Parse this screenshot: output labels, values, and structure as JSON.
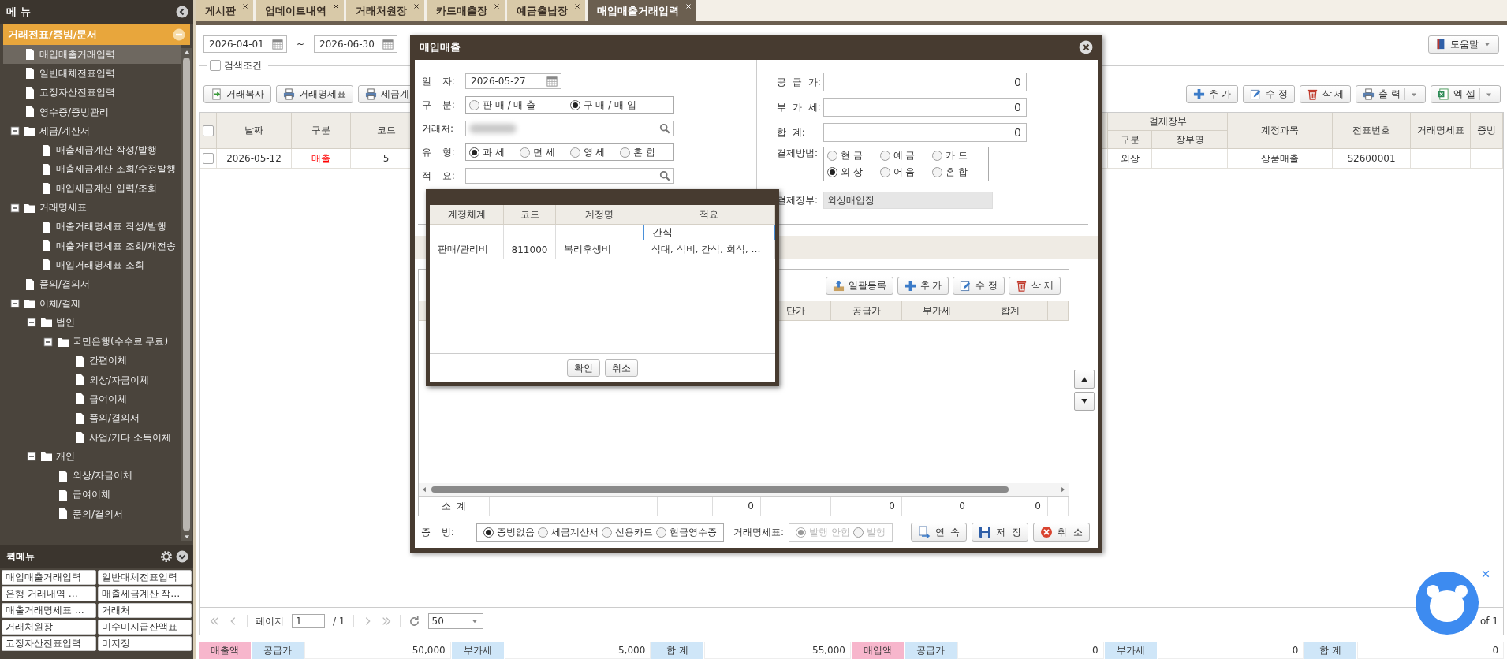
{
  "sidebar": {
    "title": "메 뉴",
    "section": {
      "label": "거래전표/증빙/문서",
      "expanded": true
    },
    "items": [
      {
        "label": "매입매출거래입력",
        "kind": "page",
        "selected": true
      },
      {
        "label": "일반대체전표입력",
        "kind": "page",
        "selected": false
      },
      {
        "label": "고정자산전표입력",
        "kind": "page",
        "selected": false
      },
      {
        "label": "영수증/증빙관리",
        "kind": "page",
        "selected": false
      },
      {
        "label": "세금/계산서",
        "kind": "folder",
        "selected": false,
        "expanded": true,
        "children": [
          {
            "label": "매출세금계산 작성/발행",
            "kind": "page",
            "selected": false
          },
          {
            "label": "매출세금계산 조회/수정발행",
            "kind": "page",
            "selected": false
          },
          {
            "label": "매입세금계산 입력/조회",
            "kind": "page",
            "selected": false
          }
        ]
      },
      {
        "label": "거래명세표",
        "kind": "folder",
        "selected": false,
        "expanded": true,
        "children": [
          {
            "label": "매출거래명세표 작성/발행",
            "kind": "page",
            "selected": false
          },
          {
            "label": "매출거래명세표 조회/재전송",
            "kind": "page",
            "selected": false
          },
          {
            "label": "매입거래명세표 조회",
            "kind": "page",
            "selected": false
          }
        ]
      },
      {
        "label": "품의/결의서",
        "kind": "page",
        "selected": false
      },
      {
        "label": "이체/결제",
        "kind": "folder",
        "selected": false,
        "expanded": true,
        "children": [
          {
            "label": "법인",
            "kind": "folder",
            "selected": false,
            "expanded": true,
            "children": [
              {
                "label": "국민은행(수수료 무료)",
                "kind": "folder",
                "selected": false,
                "expanded": true,
                "children": [
                  {
                    "label": "간편이체",
                    "kind": "page",
                    "selected": false
                  },
                  {
                    "label": "외상/자금이체",
                    "kind": "page",
                    "selected": false
                  },
                  {
                    "label": "급여이체",
                    "kind": "page",
                    "selected": false
                  },
                  {
                    "label": "품의/결의서",
                    "kind": "page",
                    "selected": false
                  },
                  {
                    "label": "사업/기타 소득이체",
                    "kind": "page",
                    "selected": false
                  }
                ]
              }
            ]
          },
          {
            "label": "개인",
            "kind": "folder",
            "selected": false,
            "expanded": true,
            "children": [
              {
                "label": "외상/자금이체",
                "kind": "page",
                "selected": false
              },
              {
                "label": "급여이체",
                "kind": "page",
                "selected": false
              },
              {
                "label": "품의/결의서",
                "kind": "page",
                "selected": false
              }
            ]
          }
        ]
      }
    ]
  },
  "quick_menu": {
    "title": "퀵메뉴",
    "items": [
      "매입매출거래입력",
      "일반대체전표입력",
      "은행 거래내역 …",
      "매출세금계산 작…",
      "매출거래명세표 …",
      "거래처",
      "거래처원장",
      "미수미지급잔액표",
      "고정자산전표입력",
      "미지정"
    ]
  },
  "tabs": [
    {
      "label": "게시판",
      "selected": false
    },
    {
      "label": "업데이트내역",
      "selected": false
    },
    {
      "label": "거래처원장",
      "selected": false
    },
    {
      "label": "카드매출장",
      "selected": false
    },
    {
      "label": "예금출납장",
      "selected": false
    },
    {
      "label": "매입매출거래입력",
      "selected": true
    }
  ],
  "filters": {
    "date_from": "2026-04-01",
    "separator": "~",
    "date_to": "2026-06-30",
    "help": "도움말"
  },
  "search_condition": {
    "label": "검색조건",
    "checked": false
  },
  "left_buttons": [
    {
      "label": "거래복사",
      "kind": "copy"
    },
    {
      "label": "거래명세표",
      "kind": "statement"
    },
    {
      "label": "세금계",
      "kind": "tax"
    }
  ],
  "right_buttons": [
    {
      "label": "추 가",
      "kind": "add"
    },
    {
      "label": "수 정",
      "kind": "edit"
    },
    {
      "label": "삭 제",
      "kind": "delete"
    },
    {
      "label": "출 력",
      "kind": "print",
      "dropdown": true
    },
    {
      "label": "엑 셀",
      "kind": "excel",
      "dropdown": true
    }
  ],
  "grid": {
    "header_checked": false,
    "columns": [
      {
        "label": "날짜"
      },
      {
        "label": "구분"
      },
      {
        "label": "코드"
      },
      {
        "label": "결제장부",
        "children": [
          "구분",
          "장부명"
        ]
      },
      {
        "label": "계정과목"
      },
      {
        "label": "전표번호"
      },
      {
        "label": "거래명세표"
      },
      {
        "label": "증빙"
      }
    ],
    "rows": [
      {
        "checked": false,
        "date": "2026-05-12",
        "division": {
          "text": "매출",
          "color": "#ff0000"
        },
        "code": "5",
        "ledger_type": "외상",
        "account": "상품매출",
        "voucher_no": "S2600001"
      }
    ]
  },
  "pager": {
    "page_label": "페이지",
    "page": "1",
    "total": "/ 1",
    "page_size": "50",
    "summary": "of 1"
  },
  "totals": [
    {
      "kind": "group",
      "text": "매출액"
    },
    {
      "kind": "label",
      "text": "공급가"
    },
    {
      "kind": "value",
      "text": "50,000"
    },
    {
      "kind": "label",
      "text": "부가세"
    },
    {
      "kind": "value",
      "text": "5,000"
    },
    {
      "kind": "label",
      "text": "합 계"
    },
    {
      "kind": "value",
      "text": "55,000"
    },
    {
      "kind": "group",
      "text": "매입액"
    },
    {
      "kind": "label",
      "text": "공급가"
    },
    {
      "kind": "value",
      "text": "0"
    },
    {
      "kind": "label",
      "text": "부가세"
    },
    {
      "kind": "value",
      "text": "0"
    },
    {
      "kind": "label",
      "text": "합 계"
    },
    {
      "kind": "value",
      "text": "0"
    }
  ],
  "dialog": {
    "title": "매입매출",
    "left": [
      {
        "kind": "date",
        "label": "일 자:",
        "value": "2026-05-27"
      },
      {
        "kind": "radio",
        "label": "구 분:",
        "options": [
          {
            "label": "판 매 / 매 출",
            "selected": false
          },
          {
            "label": "구 매 / 매 입",
            "selected": true
          }
        ]
      },
      {
        "kind": "search",
        "label": "거래처:",
        "redacted": true
      },
      {
        "kind": "radio",
        "label": "유 형:",
        "options": [
          {
            "label": "과 세",
            "selected": true
          },
          {
            "label": "면 세",
            "selected": false
          },
          {
            "label": "영 세",
            "selected": false
          },
          {
            "label": "혼 합",
            "selected": false
          }
        ]
      },
      {
        "kind": "search",
        "label": "적 요:"
      }
    ],
    "right": [
      {
        "kind": "amount",
        "label": "공 급 가:",
        "value": "0"
      },
      {
        "kind": "amount",
        "label": "부 가 세:",
        "value": "0"
      },
      {
        "kind": "amount",
        "label": "합 계:",
        "value": "0"
      },
      {
        "kind": "radio",
        "label": "결제방법:",
        "options": [
          {
            "label": "현 금",
            "selected": false
          },
          {
            "label": "예 금",
            "selected": false
          },
          {
            "label": "카 드",
            "selected": false
          },
          {
            "label": "외 상",
            "selected": true
          },
          {
            "label": "어 음",
            "selected": false
          },
          {
            "label": "혼 합",
            "selected": false
          }
        ]
      },
      {
        "kind": "readonly",
        "label": "결제장부:",
        "value": "외상매입장"
      }
    ],
    "items_panel": {
      "buttons": [
        {
          "label": "일괄등록",
          "kind": "upload"
        },
        {
          "label": "추 가",
          "kind": "add"
        },
        {
          "label": "수 정",
          "kind": "edit"
        },
        {
          "label": "삭 제",
          "kind": "delete"
        }
      ],
      "columns": [
        "단가",
        "공급가",
        "부가세",
        "합계"
      ],
      "footer": {
        "label": "소 계",
        "values": [
          "0",
          "0",
          "0",
          "0"
        ]
      }
    },
    "evidence": {
      "label": "증 빙:",
      "options": [
        {
          "label": "증빙없음",
          "selected": true
        },
        {
          "label": "세금계산서",
          "selected": false
        },
        {
          "label": "신용카드",
          "selected": false
        },
        {
          "label": "현금영수증",
          "selected": false
        }
      ]
    },
    "statement": {
      "label": "거래명세표:",
      "disabled": true,
      "options": [
        {
          "label": "발행 안함",
          "selected": true
        },
        {
          "label": "발행",
          "selected": false
        }
      ]
    },
    "actions": [
      {
        "label": "연 속",
        "kind": "continue"
      },
      {
        "label": "저 장",
        "kind": "save"
      },
      {
        "label": "취 소",
        "kind": "cancel"
      }
    ]
  },
  "account_popup": {
    "columns": [
      "계정체계",
      "코드",
      "계정명",
      "적요"
    ],
    "filter": "간식",
    "rows": [
      [
        "판매/관리비",
        "811000",
        "복리후생비",
        "식대, 식비, 간식, 회식, …"
      ]
    ],
    "buttons": [
      "확인",
      "취소"
    ]
  }
}
